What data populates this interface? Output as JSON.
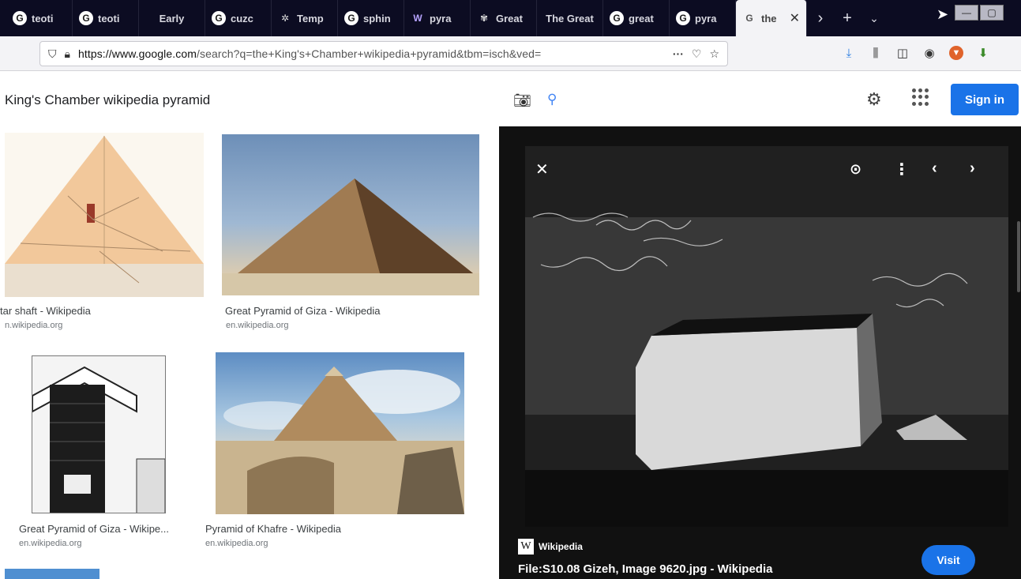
{
  "browser": {
    "tabs": [
      {
        "label": "teoti",
        "icon": "G"
      },
      {
        "label": "teoti",
        "icon": "G"
      },
      {
        "label": "Early",
        "icon": ""
      },
      {
        "label": "cuzc",
        "icon": "G"
      },
      {
        "label": "Temp",
        "icon": "✲"
      },
      {
        "label": "sphin",
        "icon": "G"
      },
      {
        "label": "pyra",
        "icon": "W"
      },
      {
        "label": "Great",
        "icon": "✾"
      },
      {
        "label": "The Great",
        "icon": ""
      },
      {
        "label": "great",
        "icon": "G"
      },
      {
        "label": "pyra",
        "icon": "G"
      }
    ],
    "active_tab": {
      "label": "the",
      "icon": "G"
    },
    "url_host": "https://www.google.com",
    "url_path": "/search?q=the+King's+Chamber+wikipedia+pyramid&tbm=isch&ved="
  },
  "search": {
    "query": "King's Chamber wikipedia pyramid",
    "signin_label": "Sign in"
  },
  "results": [
    {
      "title": "tar shaft - Wikipedia",
      "source": "n.wikipedia.org"
    },
    {
      "title": "Great Pyramid of Giza - Wikipedia",
      "source": "en.wikipedia.org"
    },
    {
      "title": "Great Pyramid of Giza - Wikipe...",
      "source": "en.wikipedia.org"
    },
    {
      "title": "Pyramid of Khafre - Wikipedia",
      "source": "en.wikipedia.org"
    }
  ],
  "preview": {
    "source_name": "Wikipedia",
    "title": "File:S10.08 Gizeh, Image 9620.jpg - Wikipedia",
    "visit_label": "Visit"
  },
  "colors": {
    "accent": "#1a73e8",
    "tabstrip": "#0c0c22",
    "preview_bg": "#111111"
  }
}
